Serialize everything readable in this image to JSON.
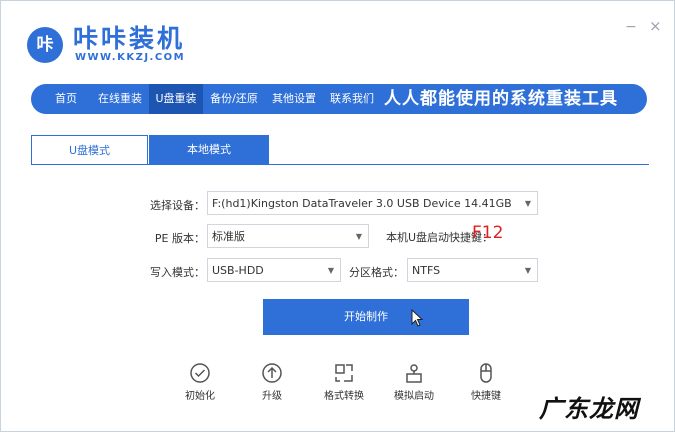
{
  "app": {
    "logo_text": "咔",
    "title": "咔咔装机",
    "url": "WWW.KKZJ.COM",
    "minimize": "−",
    "close": "×"
  },
  "nav": {
    "items": [
      {
        "label": "首页"
      },
      {
        "label": "在线重装"
      },
      {
        "label": "U盘重装"
      },
      {
        "label": "备份/还原"
      },
      {
        "label": "其他设置"
      },
      {
        "label": "联系我们"
      }
    ],
    "active": "U盘重装",
    "slogan": "人人都能使用的系统重装工具"
  },
  "tabs": [
    {
      "label": "U盘模式",
      "active": true
    },
    {
      "label": "本地模式",
      "active": false
    }
  ],
  "form": {
    "device_label": "选择设备：",
    "device_value": "F:(hd1)Kingston DataTraveler 3.0 USB Device 14.41GB",
    "pe_label": "PE 版本：",
    "pe_value": "标准版",
    "hotkey_label": "本机U盘启动快捷键：",
    "hotkey_value": "F12",
    "write_label": "写入模式：",
    "write_value": "USB-HDD",
    "partition_label": "分区格式：",
    "partition_value": "NTFS"
  },
  "start_button": "开始制作",
  "tools": [
    {
      "label": "初始化",
      "icon": "check-circle-icon"
    },
    {
      "label": "升级",
      "icon": "upload-circle-icon"
    },
    {
      "label": "格式转换",
      "icon": "convert-icon"
    },
    {
      "label": "模拟启动",
      "icon": "simulate-boot-icon"
    },
    {
      "label": "快捷键",
      "icon": "mouse-icon"
    }
  ],
  "watermark": "广东龙网",
  "colors": {
    "accent": "#2e6fd8",
    "nav_active": "#1d55b3",
    "hotkey": "#e02020"
  }
}
